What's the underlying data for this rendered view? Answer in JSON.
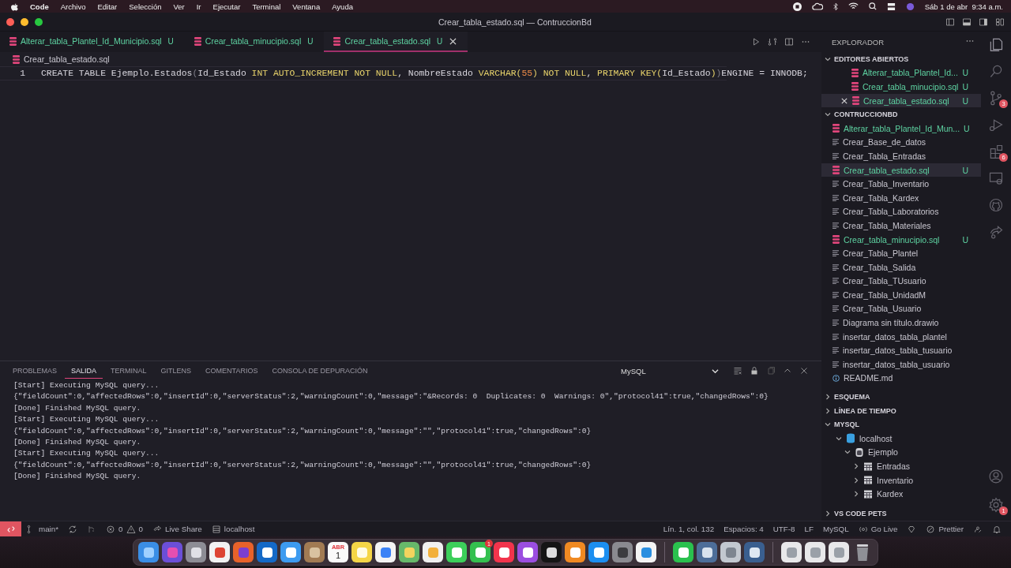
{
  "menubar": {
    "app_name": "Code",
    "menus": [
      "Archivo",
      "Editar",
      "Selección",
      "Ver",
      "Ir",
      "Ejecutar",
      "Terminal",
      "Ventana",
      "Ayuda"
    ],
    "clock": "Sáb 1 de abr  9:34 a.m."
  },
  "window": {
    "title": "Crear_tabla_estado.sql — ContruccionBd"
  },
  "tabs": [
    {
      "label": "Alterar_tabla_Plantel_Id_Municipio.sql",
      "status": "U",
      "selected": false
    },
    {
      "label": "Crear_tabla_minucipio.sql",
      "status": "U",
      "selected": false
    },
    {
      "label": "Crear_tabla_estado.sql",
      "status": "U",
      "selected": true
    }
  ],
  "breadcrumb": "Crear_tabla_estado.sql",
  "code_lines": [
    {
      "number": "1",
      "tokens": [
        {
          "text": "CREATE TABLE Ejemplo.Estados",
          "kind": "plain"
        },
        {
          "text": "(",
          "kind": "bracket"
        },
        {
          "text": "Id_Estado ",
          "kind": "plain"
        },
        {
          "text": "INT AUTO_INCREMENT NOT NULL",
          "kind": "keyword"
        },
        {
          "text": ", NombreEstado ",
          "kind": "plain"
        },
        {
          "text": "VARCHAR(",
          "kind": "keyword"
        },
        {
          "text": "55",
          "kind": "number"
        },
        {
          "text": ") NOT NULL",
          "kind": "keyword"
        },
        {
          "text": ", ",
          "kind": "plain"
        },
        {
          "text": "PRIMARY KEY(",
          "kind": "keyword"
        },
        {
          "text": "Id_Estado",
          "kind": "plain"
        },
        {
          "text": ")",
          "kind": "keyword"
        },
        {
          "text": ")",
          "kind": "bracket"
        },
        {
          "text": "ENGINE = INNODB;",
          "kind": "plain"
        }
      ]
    }
  ],
  "panel": {
    "tabs": [
      {
        "label": "PROBLEMAS",
        "selected": false
      },
      {
        "label": "SALIDA",
        "selected": true
      },
      {
        "label": "TERMINAL",
        "selected": false
      },
      {
        "label": "GITLENS",
        "selected": false
      },
      {
        "label": "COMENTARIOS",
        "selected": false
      },
      {
        "label": "CONSOLA DE DEPURACIÓN",
        "selected": false
      }
    ],
    "channel": "MySQL",
    "output": [
      "[Start] Executing MySQL query...",
      "{\"fieldCount\":0,\"affectedRows\":0,\"insertId\":0,\"serverStatus\":2,\"warningCount\":0,\"message\":\"&Records: 0  Duplicates: 0  Warnings: 0\",\"protocol41\":true,\"changedRows\":0}",
      "[Done] Finished MySQL query.",
      "[Start] Executing MySQL query...",
      "{\"fieldCount\":0,\"affectedRows\":0,\"insertId\":0,\"serverStatus\":2,\"warningCount\":0,\"message\":\"\",\"protocol41\":true,\"changedRows\":0}",
      "[Done] Finished MySQL query.",
      "[Start] Executing MySQL query...",
      "{\"fieldCount\":0,\"affectedRows\":0,\"insertId\":0,\"serverStatus\":2,\"warningCount\":0,\"message\":\"\",\"protocol41\":true,\"changedRows\":0}",
      "[Done] Finished MySQL query."
    ]
  },
  "sidebar": {
    "title": "EXPLORADOR",
    "open_editors": {
      "title": "EDITORES ABIERTOS",
      "expanded": true,
      "items": [
        {
          "label": "Alterar_tabla_Plantel_Id...",
          "status": "U",
          "selected": false
        },
        {
          "label": "Crear_tabla_minucipio.sql",
          "status": "U",
          "selected": false
        },
        {
          "label": "Crear_tabla_estado.sql",
          "status": "U",
          "selected": true
        }
      ]
    },
    "project": {
      "title": "CONTRUCCIONBD",
      "expanded": true,
      "items": [
        {
          "label": "Alterar_tabla_Plantel_Id_Mun...",
          "kind": "sql",
          "status": "U",
          "selected": false
        },
        {
          "label": "Crear_Base_de_datos",
          "kind": "text",
          "selected": false
        },
        {
          "label": "Crear_Tabla_Entradas",
          "kind": "text",
          "selected": false
        },
        {
          "label": "Crear_tabla_estado.sql",
          "kind": "sql",
          "status": "U",
          "selected": true
        },
        {
          "label": "Crear_Tabla_Inventario",
          "kind": "text",
          "selected": false
        },
        {
          "label": "Crear_Tabla_Kardex",
          "kind": "text",
          "selected": false
        },
        {
          "label": "Crear_Tabla_Laboratorios",
          "kind": "text",
          "selected": false
        },
        {
          "label": "Crear_Tabla_Materiales",
          "kind": "text",
          "selected": false
        },
        {
          "label": "Crear_tabla_minucipio.sql",
          "kind": "sql",
          "status": "U",
          "selected": false
        },
        {
          "label": "Crear_Tabla_Plantel",
          "kind": "text",
          "selected": false
        },
        {
          "label": "Crear_Tabla_Salida",
          "kind": "text",
          "selected": false
        },
        {
          "label": "Crear_Tabla_TUsuario",
          "kind": "text",
          "selected": false
        },
        {
          "label": "Crear_Tabla_UnidadM",
          "kind": "text",
          "selected": false
        },
        {
          "label": "Crear_Tabla_Usuario",
          "kind": "text",
          "selected": false
        },
        {
          "label": "Diagrama sin título.drawio",
          "kind": "text",
          "selected": false
        },
        {
          "label": "insertar_datos_tabla_plantel",
          "kind": "text",
          "selected": false
        },
        {
          "label": "insertar_datos_tabla_tusuario",
          "kind": "text",
          "selected": false
        },
        {
          "label": "insertar_datos_tabla_usuario",
          "kind": "text",
          "selected": false
        },
        {
          "label": "README.md",
          "kind": "info",
          "selected": false
        }
      ]
    },
    "sections": [
      {
        "title": "ESQUEMA",
        "expanded": false
      },
      {
        "title": "LÍNEA DE TIEMPO",
        "expanded": false
      }
    ],
    "mysql": {
      "title": "MYSQL",
      "expanded": true,
      "tree": [
        {
          "label": "localhost",
          "kind": "server",
          "expanded": true,
          "children": [
            {
              "label": "Ejemplo",
              "kind": "database",
              "expanded": true,
              "children": [
                {
                  "label": "Entradas",
                  "kind": "table",
                  "expanded": false
                },
                {
                  "label": "Inventario",
                  "kind": "table",
                  "expanded": false
                },
                {
                  "label": "Kardex",
                  "kind": "table",
                  "expanded": false
                }
              ]
            }
          ]
        }
      ]
    },
    "footer_sections": [
      {
        "title": "VS CODE PETS",
        "expanded": false
      }
    ]
  },
  "activity_bar": {
    "items": [
      {
        "kind": "files",
        "selected": true
      },
      {
        "kind": "search",
        "selected": false
      },
      {
        "kind": "source-control",
        "badge": "3",
        "selected": false
      },
      {
        "kind": "run",
        "selected": false
      },
      {
        "kind": "extensions",
        "badge": "6",
        "selected": false
      },
      {
        "kind": "remote",
        "selected": false
      },
      {
        "kind": "github",
        "selected": false
      },
      {
        "kind": "share",
        "selected": false
      }
    ],
    "bottom": [
      {
        "kind": "account",
        "selected": false
      },
      {
        "kind": "settings",
        "badge": "1",
        "selected": false
      }
    ]
  },
  "status_bar": {
    "branch": "main*",
    "errors": "0",
    "warnings": "0",
    "live_share": "Live Share",
    "connection": "localhost",
    "position": "Lín. 1, col. 132",
    "indent": "Espacios: 4",
    "encoding": "UTF-8",
    "eol": "LF",
    "language": "MySQL",
    "go_live": "Go Live",
    "prettier": "Prettier"
  },
  "dock": {
    "items": [
      {
        "kind": "finder"
      },
      {
        "kind": "siri"
      },
      {
        "kind": "launchpad"
      },
      {
        "kind": "chrome"
      },
      {
        "kind": "firefox"
      },
      {
        "kind": "outlook"
      },
      {
        "kind": "mail"
      },
      {
        "kind": "contacts"
      },
      {
        "kind": "calendar",
        "month": "ABR",
        "day": "1"
      },
      {
        "kind": "notes"
      },
      {
        "kind": "reminders"
      },
      {
        "kind": "maps"
      },
      {
        "kind": "photos"
      },
      {
        "kind": "messages"
      },
      {
        "kind": "facetime",
        "badge": "1"
      },
      {
        "kind": "music"
      },
      {
        "kind": "podcasts"
      },
      {
        "kind": "tv"
      },
      {
        "kind": "books"
      },
      {
        "kind": "appstore"
      },
      {
        "kind": "settings"
      },
      {
        "kind": "vscode"
      },
      {
        "kind": "separator"
      },
      {
        "kind": "whatsapp"
      },
      {
        "kind": "preview"
      },
      {
        "kind": "gears"
      },
      {
        "kind": "quicktime"
      },
      {
        "kind": "separator"
      },
      {
        "kind": "document"
      },
      {
        "kind": "document"
      },
      {
        "kind": "document"
      },
      {
        "kind": "trash"
      }
    ]
  }
}
